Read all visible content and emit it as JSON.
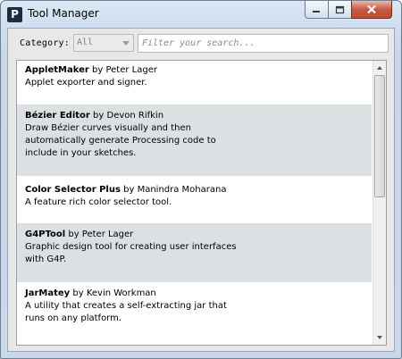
{
  "window": {
    "title": "Tool Manager",
    "app_icon_letter": "P"
  },
  "filter": {
    "category_label": "Category:",
    "category_value": "All",
    "search_placeholder": "Filter your search..."
  },
  "tools": [
    {
      "name": "AppletMaker",
      "author": "by Peter Lager",
      "desc": [
        "Applet exporter and signer."
      ]
    },
    {
      "name": "Bézier Editor",
      "author": "by Devon Rifkin",
      "desc": [
        "Draw Bézier curves visually and then",
        "automatically generate Processing code to",
        "include in your sketches."
      ]
    },
    {
      "name": "Color Selector Plus",
      "author": "by Manindra Moharana",
      "desc": [
        "A feature rich color selector tool."
      ]
    },
    {
      "name": "G4PTool",
      "author": "by Peter Lager",
      "desc": [
        "Graphic design tool for creating user interfaces",
        "with G4P."
      ]
    },
    {
      "name": "JarMatey",
      "author": "by Kevin Workman",
      "desc": [
        "A utility that creates a self-extracting jar that",
        "runs on any platform."
      ]
    }
  ]
}
